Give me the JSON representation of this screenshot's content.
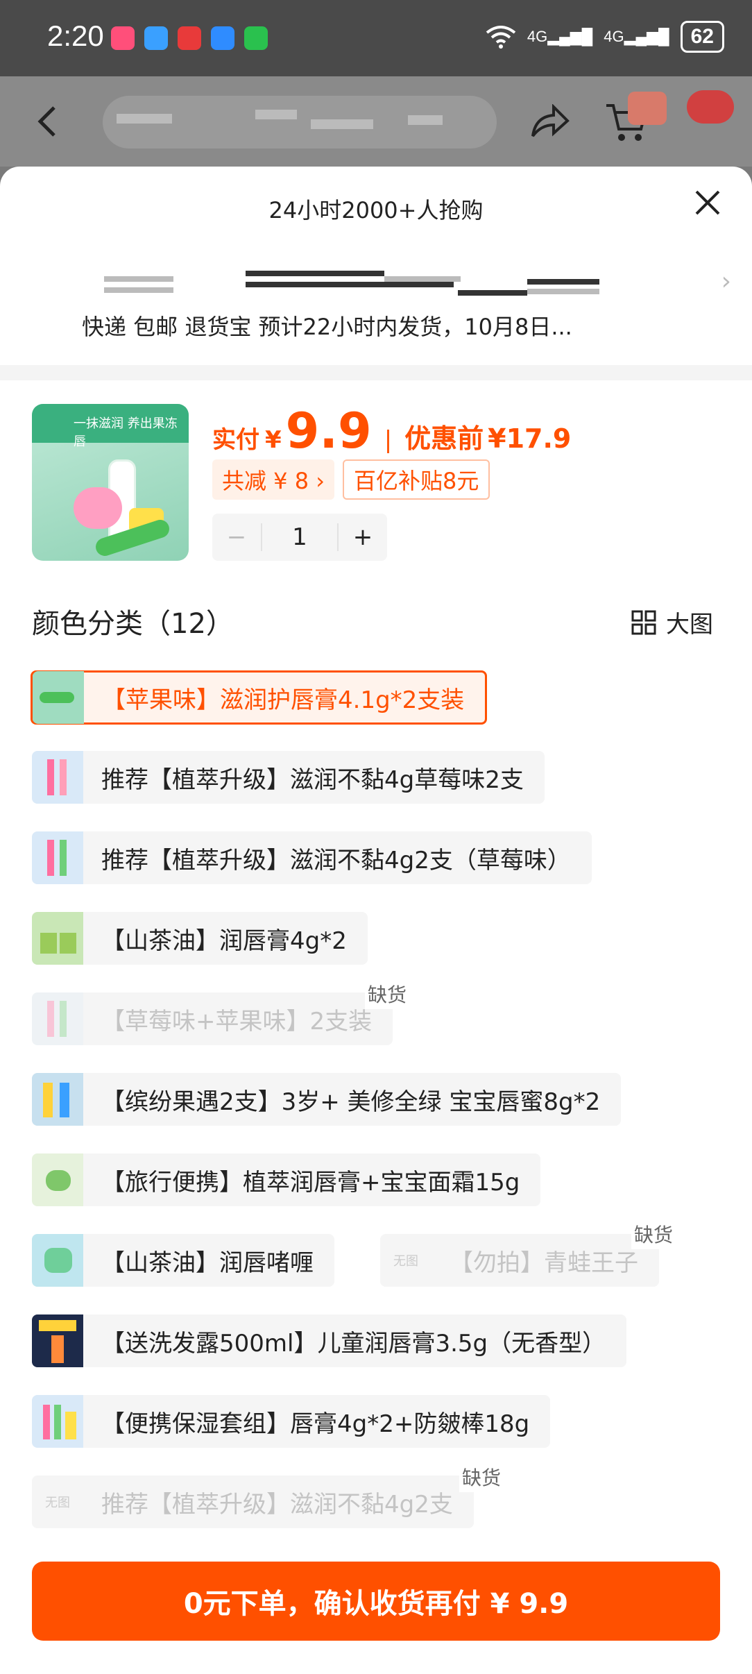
{
  "status_bar": {
    "time": "2:20",
    "battery": "62",
    "signal1": "4G",
    "signal2": "4G"
  },
  "sheet": {
    "header_title": "24小时2000+人抢购",
    "delivery_text": "快递 包邮 退货宝 预计22小时内发货，10月8日..."
  },
  "product": {
    "thumb_caption": "一抹滋润 养出果冻唇",
    "price_label": "实付",
    "currency": "¥",
    "price": "9.9",
    "sep": "|",
    "before_label": "优惠前",
    "before_price": "¥17.9",
    "discount_tag": "共减 ¥ 8 ›",
    "subsidy_tag": "百亿补贴8元",
    "qty_minus": "−",
    "quantity": "1",
    "qty_plus": "+"
  },
  "options_section": {
    "title": "颜色分类（12）",
    "big_view": "大图"
  },
  "options": [
    {
      "label": "【苹果味】滋润护唇膏4.1g*2支装",
      "state": "selected"
    },
    {
      "label": "推荐【植萃升级】滋润不黏4g草莓味2支",
      "state": "normal"
    },
    {
      "label": "推荐【植萃升级】滋润不黏4g2支（草莓味）",
      "state": "normal"
    },
    {
      "label": "【山茶油】润唇膏4g*2",
      "state": "normal"
    },
    {
      "label": "【草莓味+苹果味】2支装",
      "state": "out_of_stock",
      "stock_label": "缺货"
    },
    {
      "label": "【缤纷果遇2支】3岁+  美修全绿 宝宝唇蜜8g*2",
      "state": "normal"
    },
    {
      "label": "【旅行便携】植萃润唇膏+宝宝面霜15g",
      "state": "normal"
    },
    {
      "label": "【山茶油】润唇啫喱",
      "state": "normal"
    },
    {
      "label": "【勿拍】青蛙王子",
      "state": "out_of_stock",
      "stock_label": "缺货",
      "no_image": "无图"
    },
    {
      "label": "【送洗发露500ml】儿童润唇膏3.5g（无香型）",
      "state": "normal"
    },
    {
      "label": "【便携保湿套组】唇膏4g*2+防皴棒18g",
      "state": "normal"
    },
    {
      "label": "推荐【植萃升级】滋润不黏4g2支",
      "state": "out_of_stock",
      "stock_label": "缺货",
      "no_image": "无图"
    }
  ],
  "checkout": {
    "label": "0元下单，确认收货再付 ¥ 9.9"
  },
  "colors": {
    "accent": "#ff5000"
  }
}
